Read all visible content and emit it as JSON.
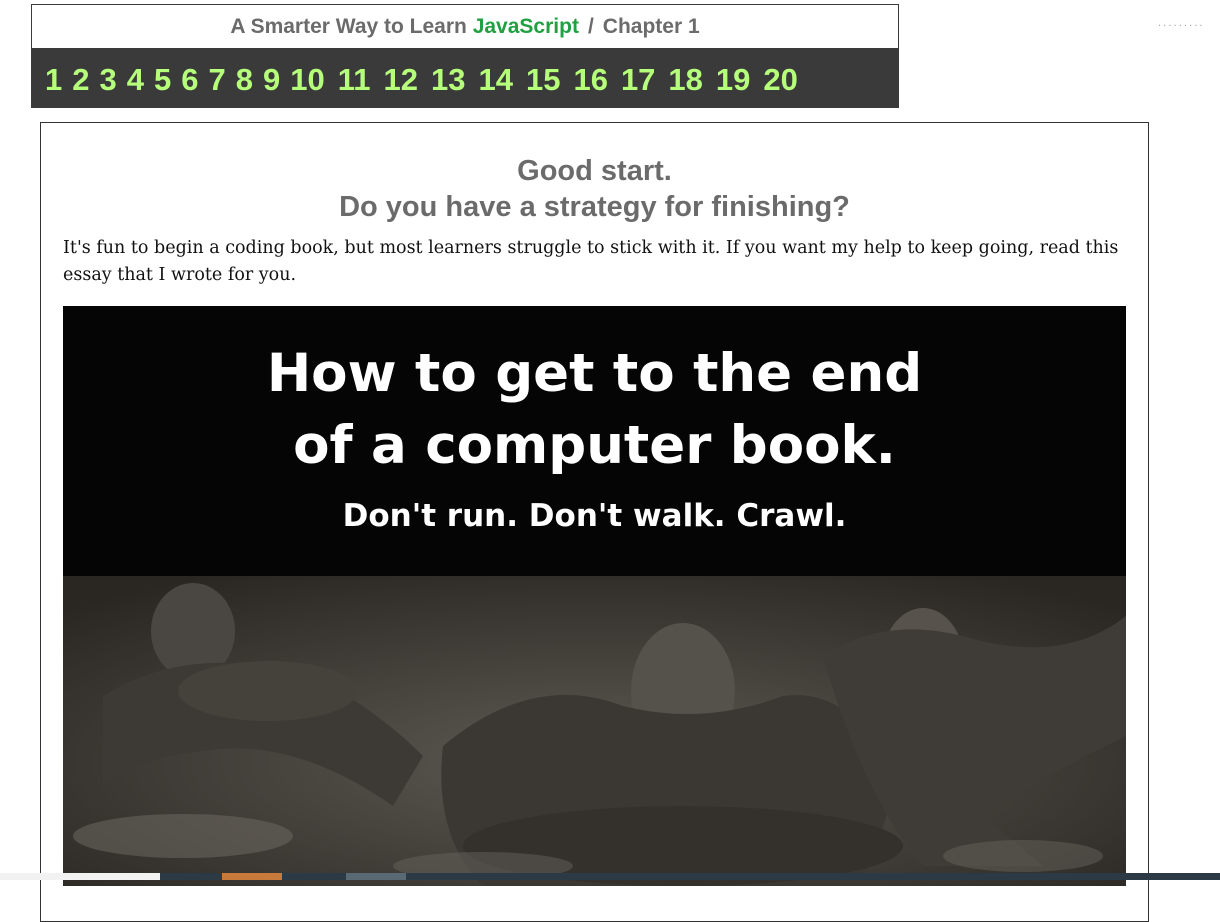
{
  "header": {
    "title_prefix": "A Smarter Way to Learn",
    "title_brand": "JavaScript",
    "title_separator": "/",
    "chapter_label": "Chapter 1"
  },
  "chapters": [
    "1",
    "2",
    "3",
    "4",
    "5",
    "6",
    "7",
    "8",
    "9",
    "10",
    "11",
    "12",
    "13",
    "14",
    "15",
    "16",
    "17",
    "18",
    "19",
    "20"
  ],
  "content": {
    "headline_1": "Good start.",
    "headline_2": "Do you have a strategy for finishing?",
    "intro": "It's fun to begin a coding book, but most learners struggle to stick with it. If you want my help to keep going, read this essay that I wrote for you."
  },
  "promo": {
    "title_line_1": "How to get to the end",
    "title_line_2": "of a computer book.",
    "subtitle": "Don't run. Don't walk. Crawl."
  },
  "colors": {
    "brand_green": "#20a040",
    "chapter_link": "#b6ff7a",
    "nav_background": "#3a3a3a",
    "headline_gray": "#6b6b6b"
  }
}
